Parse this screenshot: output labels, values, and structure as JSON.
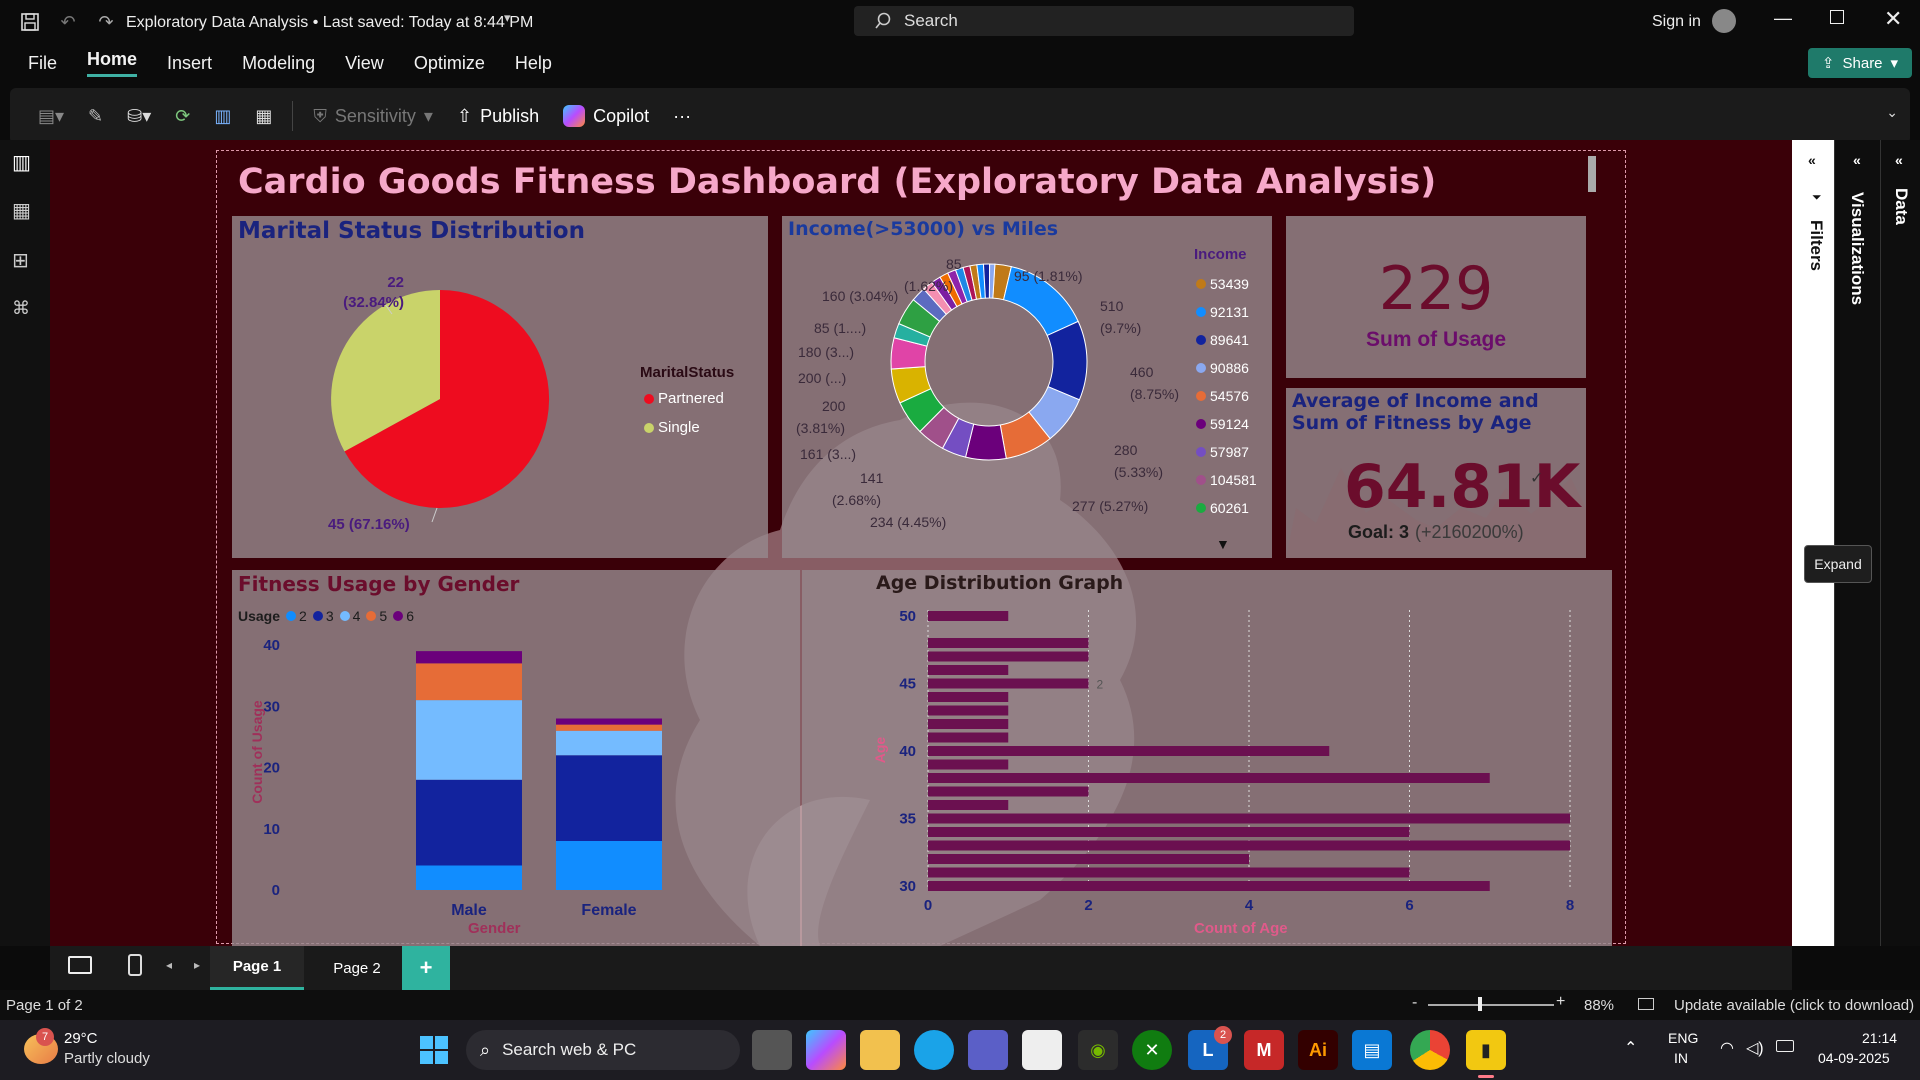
{
  "window": {
    "title": "Exploratory Data Analysis • Last saved: Today at 8:44 PM",
    "search_placeholder": "Search",
    "sign_in": "Sign in",
    "share": "Share"
  },
  "menu": [
    "File",
    "Home",
    "Insert",
    "Modeling",
    "View",
    "Optimize",
    "Help"
  ],
  "ribbon": {
    "sensitivity": "Sensitivity",
    "publish": "Publish",
    "copilot": "Copilot",
    "more": "···"
  },
  "dashboard": {
    "title": "Cardio Goods Fitness Dashboard (Exploratory Data Analysis)",
    "marital": {
      "title": "Marital Status Distribution",
      "legend_title": "MaritalStatus",
      "label_single": "22",
      "label_single2": "(32.84%)",
      "label_partnered": "45 (67.16%)"
    },
    "income": {
      "title": "Income(>53000) vs Miles",
      "legend_title": "Income",
      "labels": [
        "85",
        "95 (1.81%)",
        "160 (3.04%)",
        "(1.62%)",
        "510",
        "(9.7%)",
        "85 (1....)",
        "180 (3...)",
        "460",
        "(8.75%)",
        "200 (...)",
        "200",
        "(3.81%)",
        "280",
        "161 (3...)",
        "(5.33%)",
        "141",
        "(2.68%)",
        "277 (5.27%)",
        "234 (4.45%)"
      ]
    },
    "kpi": {
      "value": "229",
      "label": "Sum of Usage"
    },
    "avg": {
      "title": "Average of Income and Sum of Fitness by Age",
      "value": "64.81K",
      "goal_label": "Goal: 3",
      "goal_delta": "(+2160200%)"
    },
    "fitness": {
      "title": "Fitness Usage by Gender",
      "legend_title": "Usage",
      "ylabel": "Count of Usage",
      "xlabel": "Gender"
    },
    "age": {
      "title": "Age Distribution Graph",
      "ylabel": "Age",
      "xlabel": "Count of Age"
    }
  },
  "chart_data": [
    {
      "type": "pie",
      "title": "Marital Status Distribution",
      "categories": [
        "Partnered",
        "Single"
      ],
      "values": [
        45,
        22
      ],
      "percentages": [
        67.16,
        32.84
      ],
      "colors": [
        "#ee0c1f",
        "#c9d36a"
      ],
      "legend_placement": "right"
    },
    {
      "type": "pie",
      "donut": true,
      "title": "Income(>53000) vs Miles",
      "categories": [
        "53439",
        "92131",
        "89641",
        "90886",
        "54576",
        "59124",
        "57987",
        "104581",
        "60261"
      ],
      "legend_colors": [
        "#c07a18",
        "#118dff",
        "#12239e",
        "#8aa8f0",
        "#e66c37",
        "#6b007b",
        "#744ec2",
        "#a0508a",
        "#1aab40"
      ],
      "slice_values": [
        95,
        510,
        460,
        280,
        277,
        234,
        141,
        161,
        200,
        200,
        180,
        85,
        160,
        85
      ],
      "legend_placement": "right"
    },
    {
      "type": "bar",
      "stacked": true,
      "title": "Fitness Usage by Gender",
      "categories": [
        "Male",
        "Female"
      ],
      "xlabel": "Gender",
      "ylabel": "Count of Usage",
      "ylim": [
        0,
        40
      ],
      "yticks": [
        0,
        10,
        20,
        30,
        40
      ],
      "series": [
        {
          "name": "2",
          "color": "#118dff",
          "values": [
            4,
            8
          ]
        },
        {
          "name": "3",
          "color": "#12239e",
          "values": [
            14,
            14
          ]
        },
        {
          "name": "4",
          "color": "#74bbff",
          "values": [
            13,
            4
          ]
        },
        {
          "name": "5",
          "color": "#e66c37",
          "values": [
            6,
            1
          ]
        },
        {
          "name": "6",
          "color": "#6b007b",
          "values": [
            2,
            1
          ]
        }
      ],
      "legend_placement": "top-left"
    },
    {
      "type": "bar",
      "orientation": "horizontal",
      "title": "Age Distribution Graph",
      "xlabel": "Count of Age",
      "ylabel": "Age",
      "xlim": [
        0,
        8
      ],
      "xticks": [
        0,
        2,
        4,
        6,
        8
      ],
      "yticks": [
        30,
        35,
        40,
        45,
        50
      ],
      "ages": [
        50,
        48,
        47,
        46,
        45,
        44,
        43,
        42,
        41,
        40,
        39,
        38,
        37,
        36,
        35,
        34,
        33,
        32,
        31,
        30
      ],
      "values": [
        1,
        2,
        2,
        1,
        2,
        1,
        1,
        1,
        1,
        5,
        1,
        7,
        2,
        1,
        8,
        6,
        8,
        4,
        6,
        7
      ],
      "data_labels": {
        "45": "2"
      }
    }
  ],
  "pages": {
    "tabs": [
      "Page 1",
      "Page 2"
    ],
    "add": "+"
  },
  "side": {
    "filters": "Filters",
    "visualizations": "Visualizations",
    "data": "Data",
    "expand": "Expand"
  },
  "status": {
    "page": "Page 1 of 2",
    "zoom": "88%",
    "update": "Update available (click to download)"
  },
  "taskbar": {
    "temp": "29°C",
    "weather": "Partly cloudy",
    "search": "Search web & PC",
    "lang1": "ENG",
    "lang2": "IN",
    "time": "21:14",
    "date": "04-09-2025",
    "badge_weather": "7",
    "badge_l": "2"
  }
}
